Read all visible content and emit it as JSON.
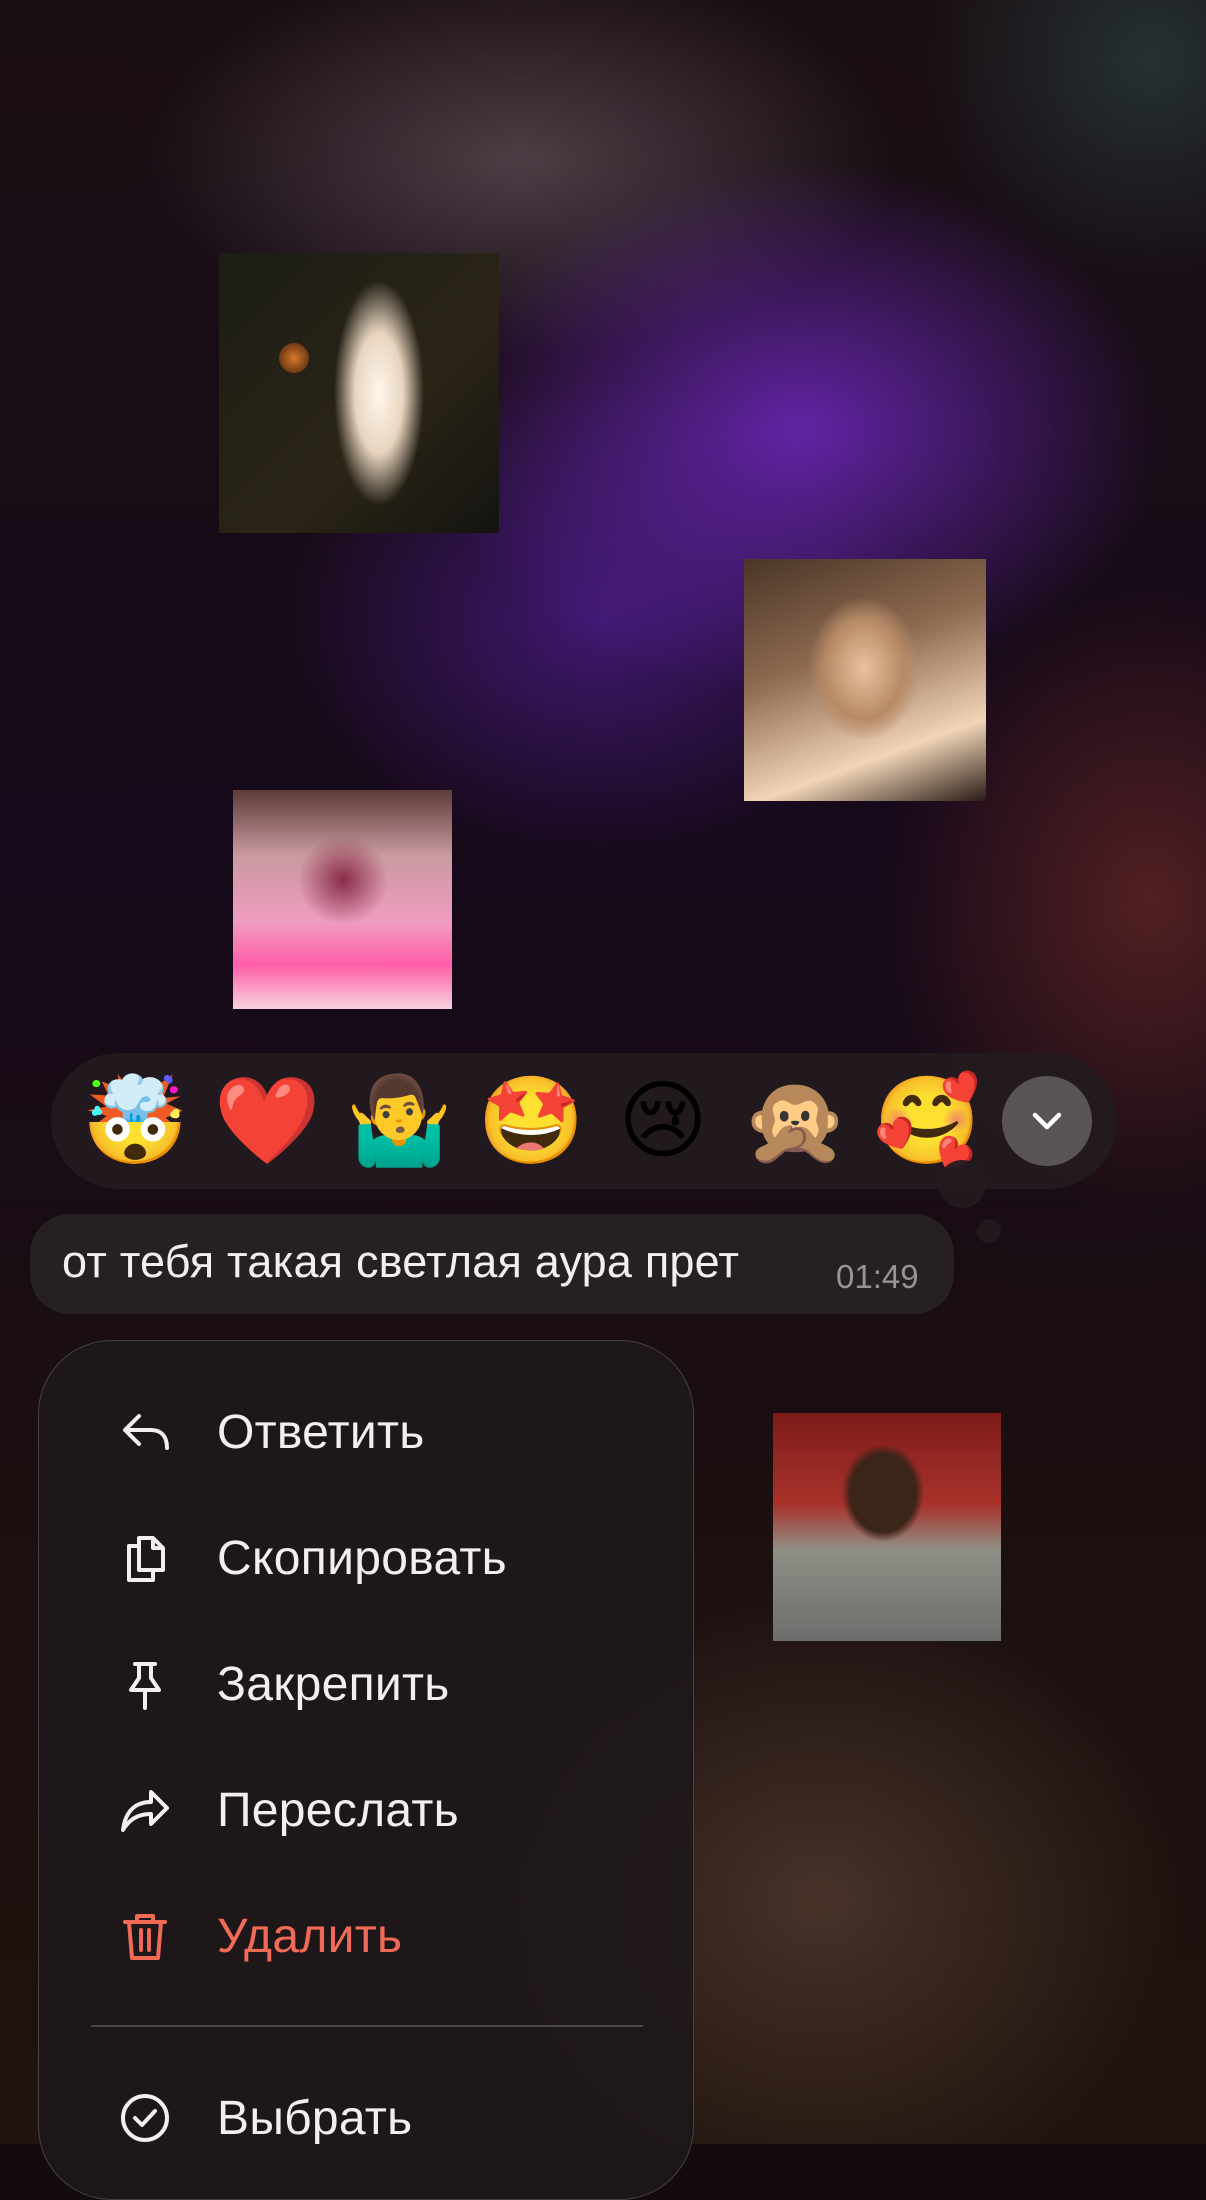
{
  "stickers": [
    {
      "name": "sticker-glowing-figure"
    },
    {
      "name": "sticker-girl-portrait"
    },
    {
      "name": "sticker-girl-on-bed"
    },
    {
      "name": "sticker-man-shouting"
    }
  ],
  "reactions": {
    "items": [
      {
        "emoji": "🤯",
        "icon": "exploding-head-emoji"
      },
      {
        "emoji": "❤️",
        "icon": "red-heart-emoji"
      },
      {
        "emoji": "🤷‍♂️",
        "icon": "man-shrugging-emoji"
      },
      {
        "emoji": "🤩",
        "icon": "star-struck-emoji"
      },
      {
        "emoji": "😢",
        "icon": "crying-face-emoji"
      },
      {
        "emoji": "🙊",
        "icon": "speak-no-evil-monkey-emoji"
      },
      {
        "emoji": "🥰",
        "icon": "smiling-face-with-hearts-emoji"
      }
    ],
    "more_icon": "chevron-down-icon"
  },
  "message": {
    "text": "от тебя такая светлая аура прет",
    "time": "01:49"
  },
  "menu": {
    "items": [
      {
        "label": "Ответить",
        "icon": "reply-icon"
      },
      {
        "label": "Скопировать",
        "icon": "copy-icon"
      },
      {
        "label": "Закрепить",
        "icon": "pin-icon"
      },
      {
        "label": "Переслать",
        "icon": "forward-icon"
      },
      {
        "label": "Удалить",
        "icon": "trash-icon",
        "color": "#f16a56"
      },
      {
        "label": "Выбрать",
        "icon": "check-circle-icon"
      }
    ]
  },
  "colors": {
    "danger": "#f16a56",
    "text": "#f2efef",
    "accent_purple": "#6e28be"
  }
}
